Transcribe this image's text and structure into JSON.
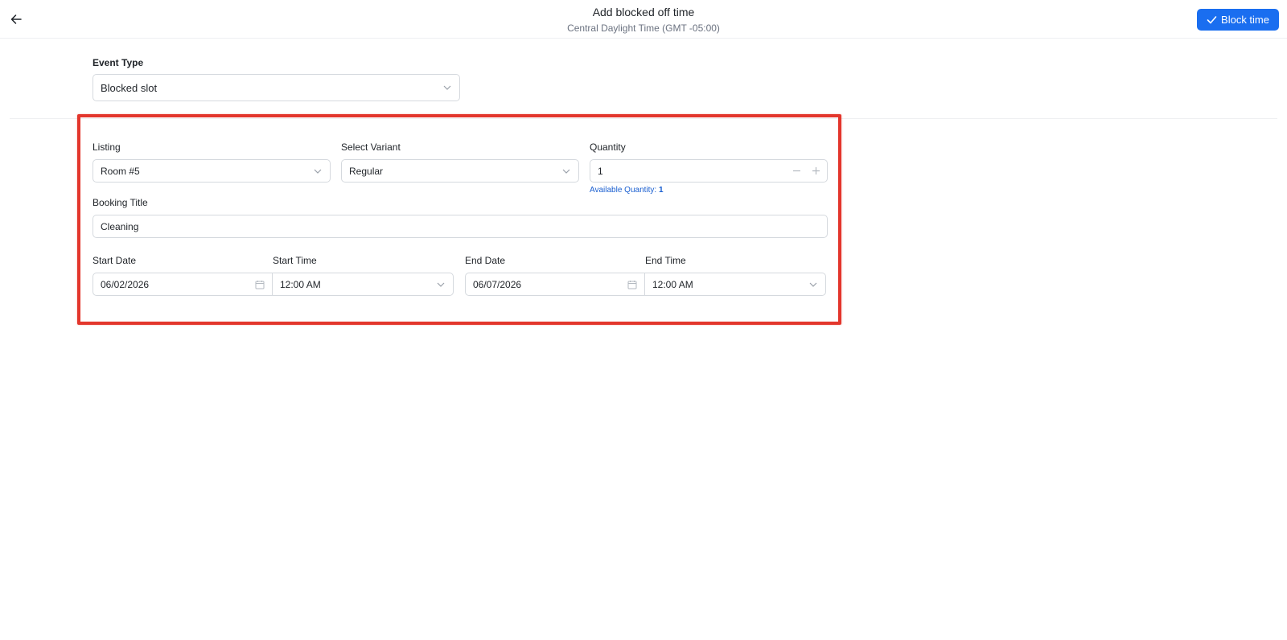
{
  "header": {
    "title": "Add blocked off time",
    "subtitle": "Central Daylight Time (GMT -05:00)",
    "block_button": "Block time"
  },
  "event_type": {
    "label": "Event Type",
    "value": "Blocked slot"
  },
  "form": {
    "listing": {
      "label": "Listing",
      "value": "Room #5"
    },
    "variant": {
      "label": "Select Variant",
      "value": "Regular"
    },
    "quantity": {
      "label": "Quantity",
      "value": "1",
      "available_label": "Available Quantity:",
      "available_value": "1"
    },
    "booking_title": {
      "label": "Booking Title",
      "value": "Cleaning"
    },
    "start_date": {
      "label": "Start Date",
      "value": "06/02/2026"
    },
    "start_time": {
      "label": "Start Time",
      "value": "12:00 AM"
    },
    "end_date": {
      "label": "End Date",
      "value": "06/07/2026"
    },
    "end_time": {
      "label": "End Time",
      "value": "12:00 AM"
    }
  },
  "colors": {
    "primary": "#1a6ef0",
    "highlight": "#e3362c",
    "link": "#1a5fd0"
  }
}
